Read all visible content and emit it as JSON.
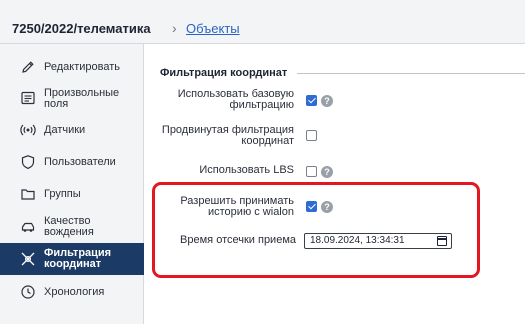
{
  "breadcrumb": {
    "current": "7250/2022/телематика",
    "separator": "›",
    "link": "Объекты"
  },
  "sidebar": {
    "items": [
      {
        "label": "Редактировать",
        "icon": "edit-pencil-icon",
        "active": false
      },
      {
        "label": "Произвольные\nполя",
        "icon": "custom-fields-icon",
        "active": false
      },
      {
        "label": "Датчики",
        "icon": "sensor-signal-icon",
        "active": false
      },
      {
        "label": "Пользователи",
        "icon": "user-shield-icon",
        "active": false
      },
      {
        "label": "Группы",
        "icon": "group-folder-icon",
        "active": false
      },
      {
        "label": "Качество\nвождения",
        "icon": "driving-quality-icon",
        "active": false
      },
      {
        "label": "Фильтрация\nкоординат",
        "icon": "coordinate-filter-icon",
        "active": true
      },
      {
        "label": "Хронология",
        "icon": "chronology-clock-icon",
        "active": false
      }
    ]
  },
  "section": {
    "title": "Фильтрация координат"
  },
  "settings": [
    {
      "label": "Использовать базовую\nфильтрацию",
      "checked": true,
      "help": true
    },
    {
      "label": "Продвинутая фильтрация\nкоординат",
      "checked": false,
      "help": false
    },
    {
      "label": "Использовать LBS",
      "checked": false,
      "help": true
    },
    {
      "label": "Разрешить принимать\nисторию с wialon",
      "checked": true,
      "help": true
    }
  ],
  "cutoff": {
    "label": "Время отсечки приема",
    "value": "18.09.2024, 13:34:31"
  },
  "colors": {
    "accent": "#2f6bd4",
    "sidebar_active": "#1c3a66",
    "highlight_box": "#e4161f",
    "link": "#2b63c4"
  }
}
